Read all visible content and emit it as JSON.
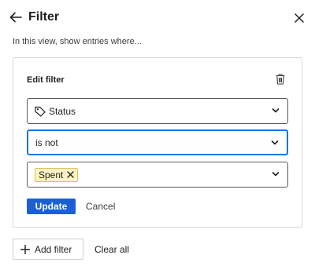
{
  "header": {
    "title": "Filter",
    "back_icon": "arrow-left-icon",
    "close_icon": "close-icon"
  },
  "subtitle": "In this view, show entries where...",
  "editor": {
    "title": "Edit filter",
    "delete_icon": "trash-icon",
    "field": {
      "icon": "tag-icon",
      "value": "Status"
    },
    "operator": {
      "value": "is not"
    },
    "values": {
      "chips": [
        "Spent"
      ]
    },
    "update_label": "Update",
    "cancel_label": "Cancel"
  },
  "footer": {
    "add_filter_label": "Add filter",
    "clear_all_label": "Clear all"
  },
  "colors": {
    "primary": "#1a5fd4",
    "focus_border": "#1a73e8",
    "chip_bg": "#fdf3c4",
    "chip_border": "#d9c15a"
  }
}
